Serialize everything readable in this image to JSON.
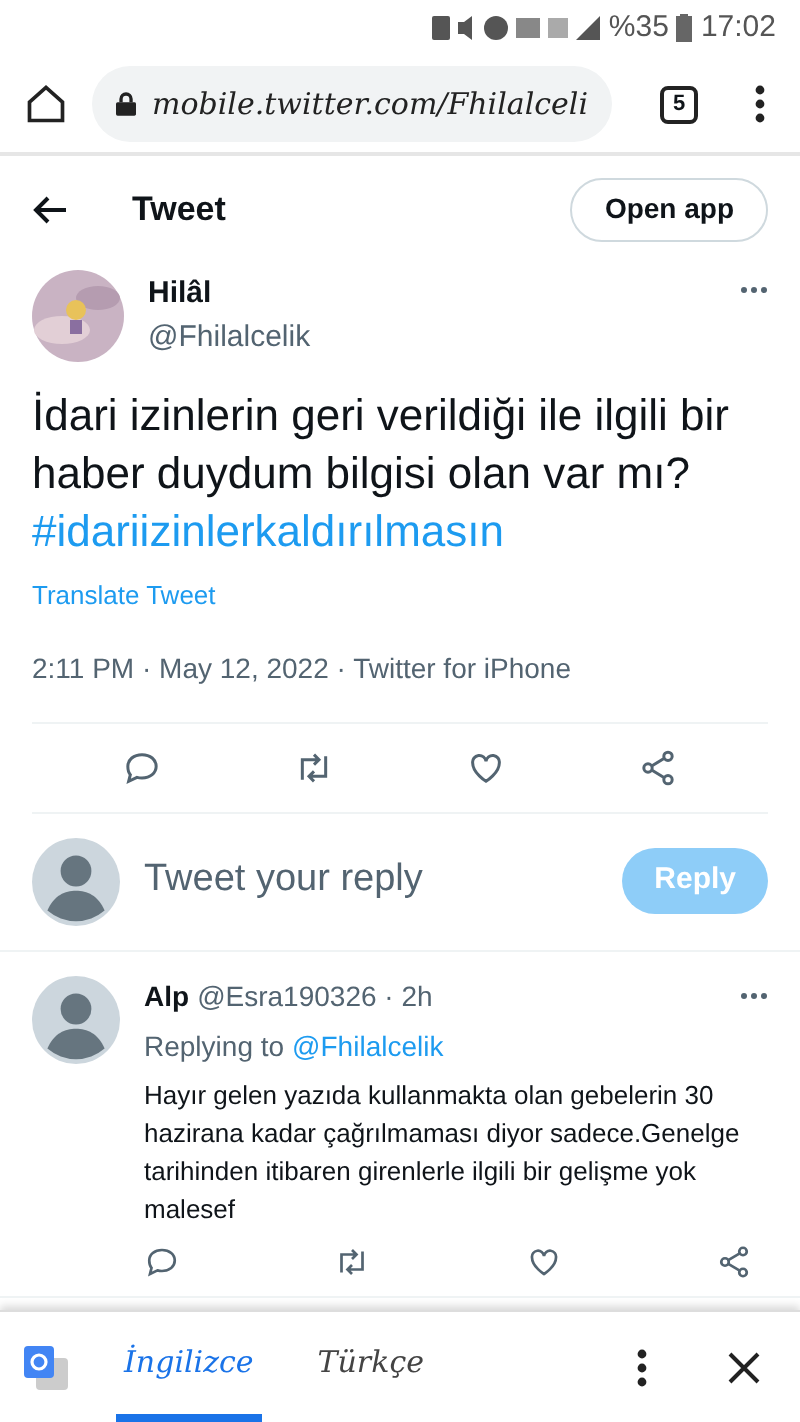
{
  "status_bar": {
    "battery": "%35",
    "time": "17:02"
  },
  "browser": {
    "url": "mobile.twitter.com/Fhilalceli",
    "tab_count": "5"
  },
  "header": {
    "title": "Tweet",
    "open_app": "Open app"
  },
  "tweet": {
    "name": "Hilâl",
    "handle": "@Fhilalcelik",
    "text": "İdari izinlerin geri verildiği ile ilgili bir haber duydum bilgisi olan var mı?",
    "hashtag": "#idariizinlerkaldırılmasın",
    "translate": "Translate Tweet",
    "meta": "2:11 PM · May 12, 2022 · Twitter for iPhone"
  },
  "composer": {
    "placeholder": "Tweet your reply",
    "button": "Reply",
    "disabled": true
  },
  "replies": [
    {
      "name": "Alp",
      "handle": "@Esra190326 · 2h",
      "replying_label": "Replying to",
      "replying_handle": "@Fhilalcelik",
      "text": "Hayır gelen yazıda kullanmakta olan gebelerin 30 hazirana kadar çağrılmaması diyor sadece.Genelge tarihinden itibaren girenlerle ilgili bir gelişme yok malesef"
    }
  ],
  "translate_bar": {
    "tabs": [
      {
        "label": "İngilizce",
        "selected": true
      },
      {
        "label": "Türkçe",
        "selected": false
      }
    ]
  }
}
